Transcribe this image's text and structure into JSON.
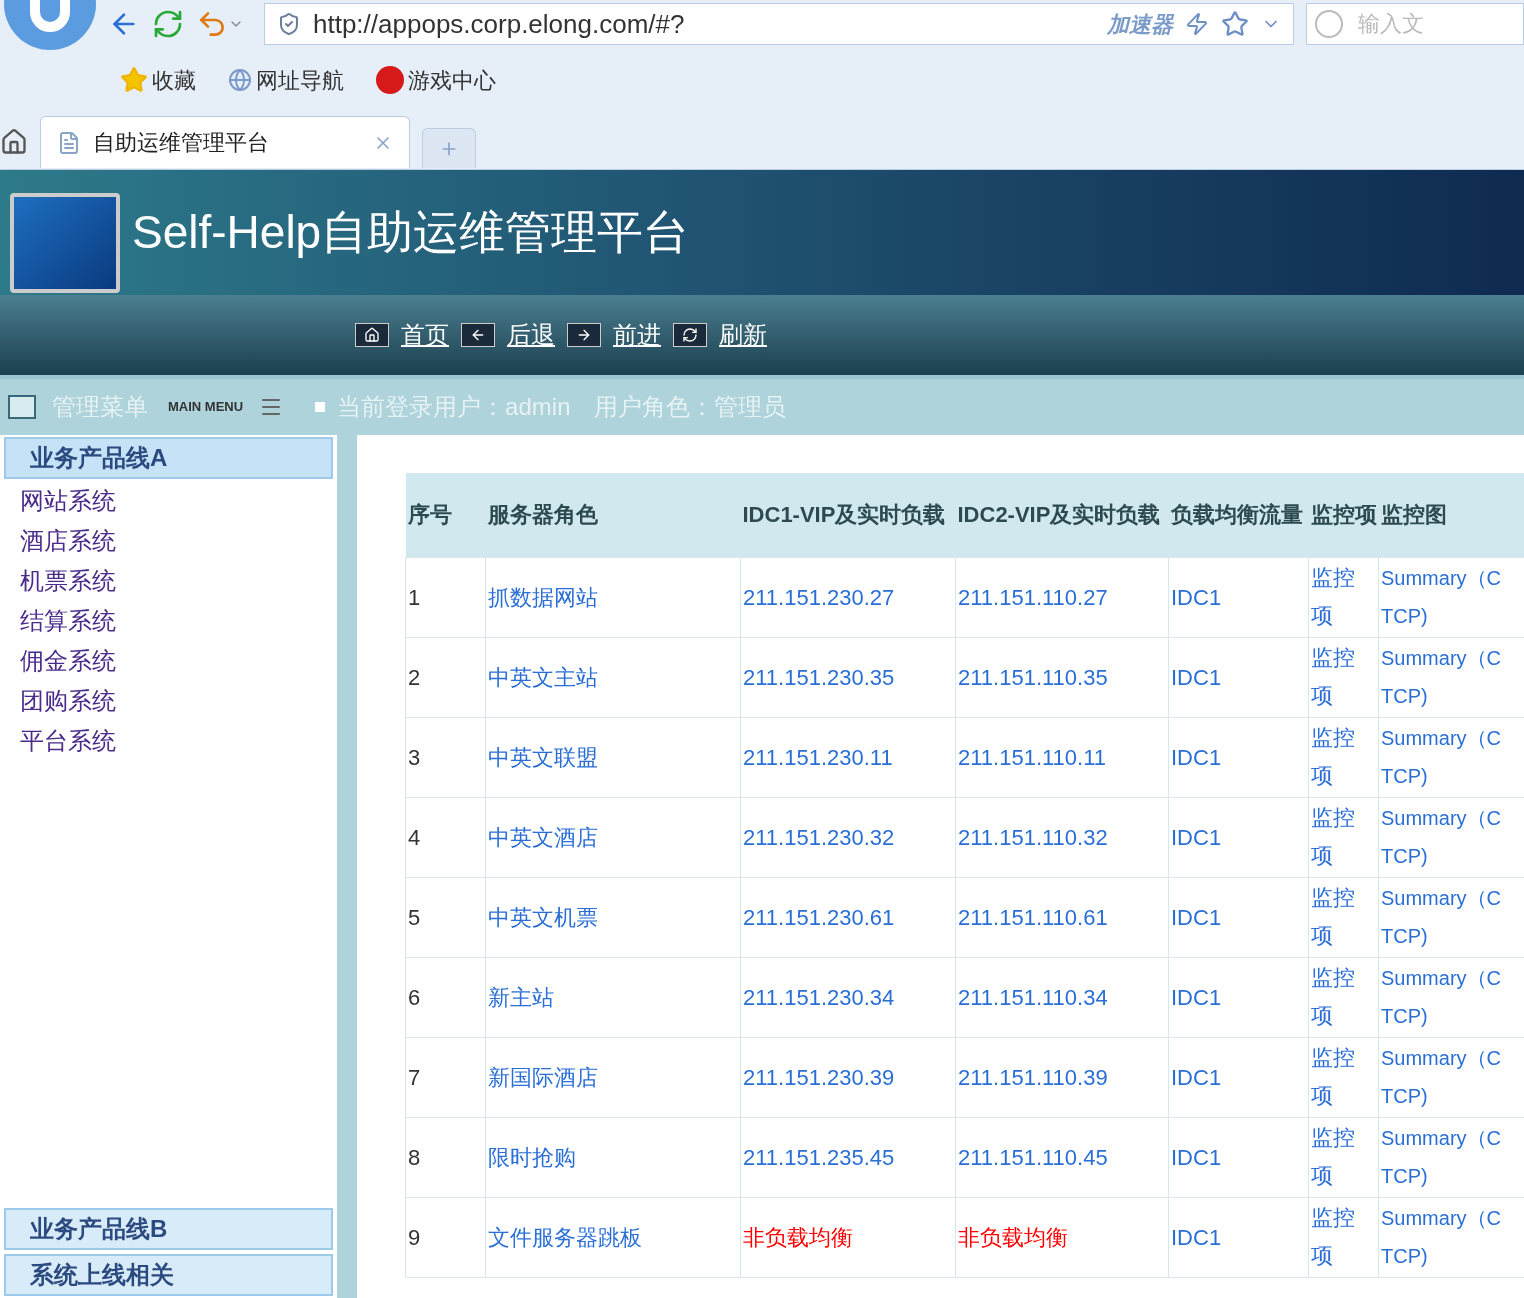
{
  "browser": {
    "url": "http://appops.corp.elong.com/#?",
    "accelerator": "加速器",
    "search": {
      "placeholder": "输入文"
    },
    "bookmarks": [
      "收藏",
      "网址导航",
      "游戏中心"
    ],
    "tabs": [
      {
        "label": "自助运维管理平台",
        "selected": true
      }
    ]
  },
  "header": {
    "title": "Self-Help自助运维管理平台",
    "nav": [
      "首页",
      "后退",
      "前进",
      "刷新"
    ]
  },
  "info_bar": {
    "menu_title": "管理菜单",
    "menu_subtitle": "MAIN MENU",
    "user": "当前登录用户：admin",
    "role": "用户角色：管理员"
  },
  "sidebar": {
    "groups": [
      {
        "title": "业务产品线A",
        "expanded": true,
        "items": [
          "网站系统",
          "酒店系统",
          "机票系统",
          "结算系统",
          "佣金系统",
          "团购系统",
          "平台系统"
        ]
      },
      {
        "title": "业务产品线B",
        "expanded": false
      },
      {
        "title": "系统上线相关",
        "expanded": false
      }
    ]
  },
  "table": {
    "columns": [
      "序号",
      "服务器角色",
      "IDC1-VIP及实时负载",
      "IDC2-VIP及实时负载",
      "负载均衡流量",
      "监控项",
      "监控图"
    ],
    "rows": [
      {
        "no": "1",
        "role": "抓数据网站",
        "kind": "vip",
        "idc1": "211.151.230.27",
        "idc2": "211.151.110.27",
        "lb": "IDC1",
        "monitor": "监控项",
        "chart": [
          "Summary（C",
          "TCP)"
        ]
      },
      {
        "no": "2",
        "role": "中英文主站",
        "kind": "vip",
        "idc1": "211.151.230.35",
        "idc2": "211.151.110.35",
        "lb": "IDC1",
        "monitor": "监控项",
        "chart": [
          "Summary（C",
          "TCP)"
        ]
      },
      {
        "no": "3",
        "role": "中英文联盟",
        "kind": "vip",
        "idc1": "211.151.230.11",
        "idc2": "211.151.110.11",
        "lb": "IDC1",
        "monitor": "监控项",
        "chart": [
          "Summary（C",
          "TCP)"
        ]
      },
      {
        "no": "4",
        "role": "中英文酒店",
        "kind": "vip",
        "idc1": "211.151.230.32",
        "idc2": "211.151.110.32",
        "lb": "IDC1",
        "monitor": "监控项",
        "chart": [
          "Summary（C",
          "TCP)"
        ]
      },
      {
        "no": "5",
        "role": "中英文机票",
        "kind": "vip",
        "idc1": "211.151.230.61",
        "idc2": "211.151.110.61",
        "lb": "IDC1",
        "monitor": "监控项",
        "chart": [
          "Summary（C",
          "TCP)"
        ]
      },
      {
        "no": "6",
        "role": "新主站",
        "kind": "vip",
        "idc1": "211.151.230.34",
        "idc2": "211.151.110.34",
        "lb": "IDC1",
        "monitor": "监控项",
        "chart": [
          "Summary（C",
          "TCP)"
        ]
      },
      {
        "no": "7",
        "role": "新国际酒店",
        "kind": "vip",
        "idc1": "211.151.230.39",
        "idc2": "211.151.110.39",
        "lb": "IDC1",
        "monitor": "监控项",
        "chart": [
          "Summary（C",
          "TCP)"
        ]
      },
      {
        "no": "8",
        "role": "限时抢购",
        "kind": "vip",
        "idc1": "211.151.235.45",
        "idc2": "211.151.110.45",
        "lb": "IDC1",
        "monitor": "监控项",
        "chart": [
          "Summary（C",
          "TCP)"
        ]
      },
      {
        "no": "9",
        "role": "文件服务器跳板",
        "kind": "none",
        "idc1": "非负载均衡",
        "idc2": "非负载均衡",
        "lb": "IDC1",
        "monitor": "监控项",
        "chart": [
          "Summary（C",
          "TCP)"
        ]
      }
    ]
  }
}
